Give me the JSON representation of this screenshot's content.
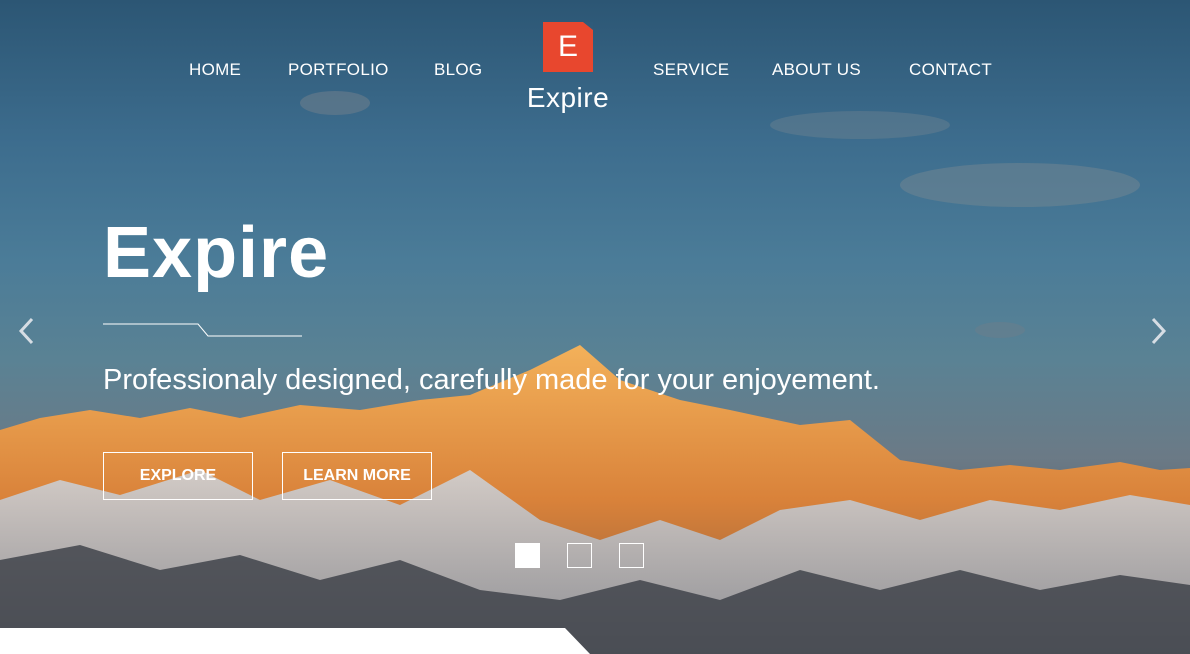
{
  "brand": {
    "logo_letter": "E",
    "name": "Expire",
    "logo_color": "#e8472e"
  },
  "nav": {
    "left": [
      "HOME",
      "PORTFOLIO",
      "BLOG"
    ],
    "right": [
      "SERVICE",
      "ABOUT US",
      "CONTACT"
    ]
  },
  "hero": {
    "headline": "Expire",
    "tagline": "Professionaly designed, carefully made for your enjoyement.",
    "explore_label": "EXPLORE",
    "learn_more_label": "LEARN MORE"
  },
  "slider": {
    "slide_count": 3,
    "active_slide": 1,
    "prev_icon": "chevron-left-icon",
    "next_icon": "chevron-right-icon"
  },
  "colors": {
    "accent": "#e8472e",
    "text": "#ffffff"
  }
}
